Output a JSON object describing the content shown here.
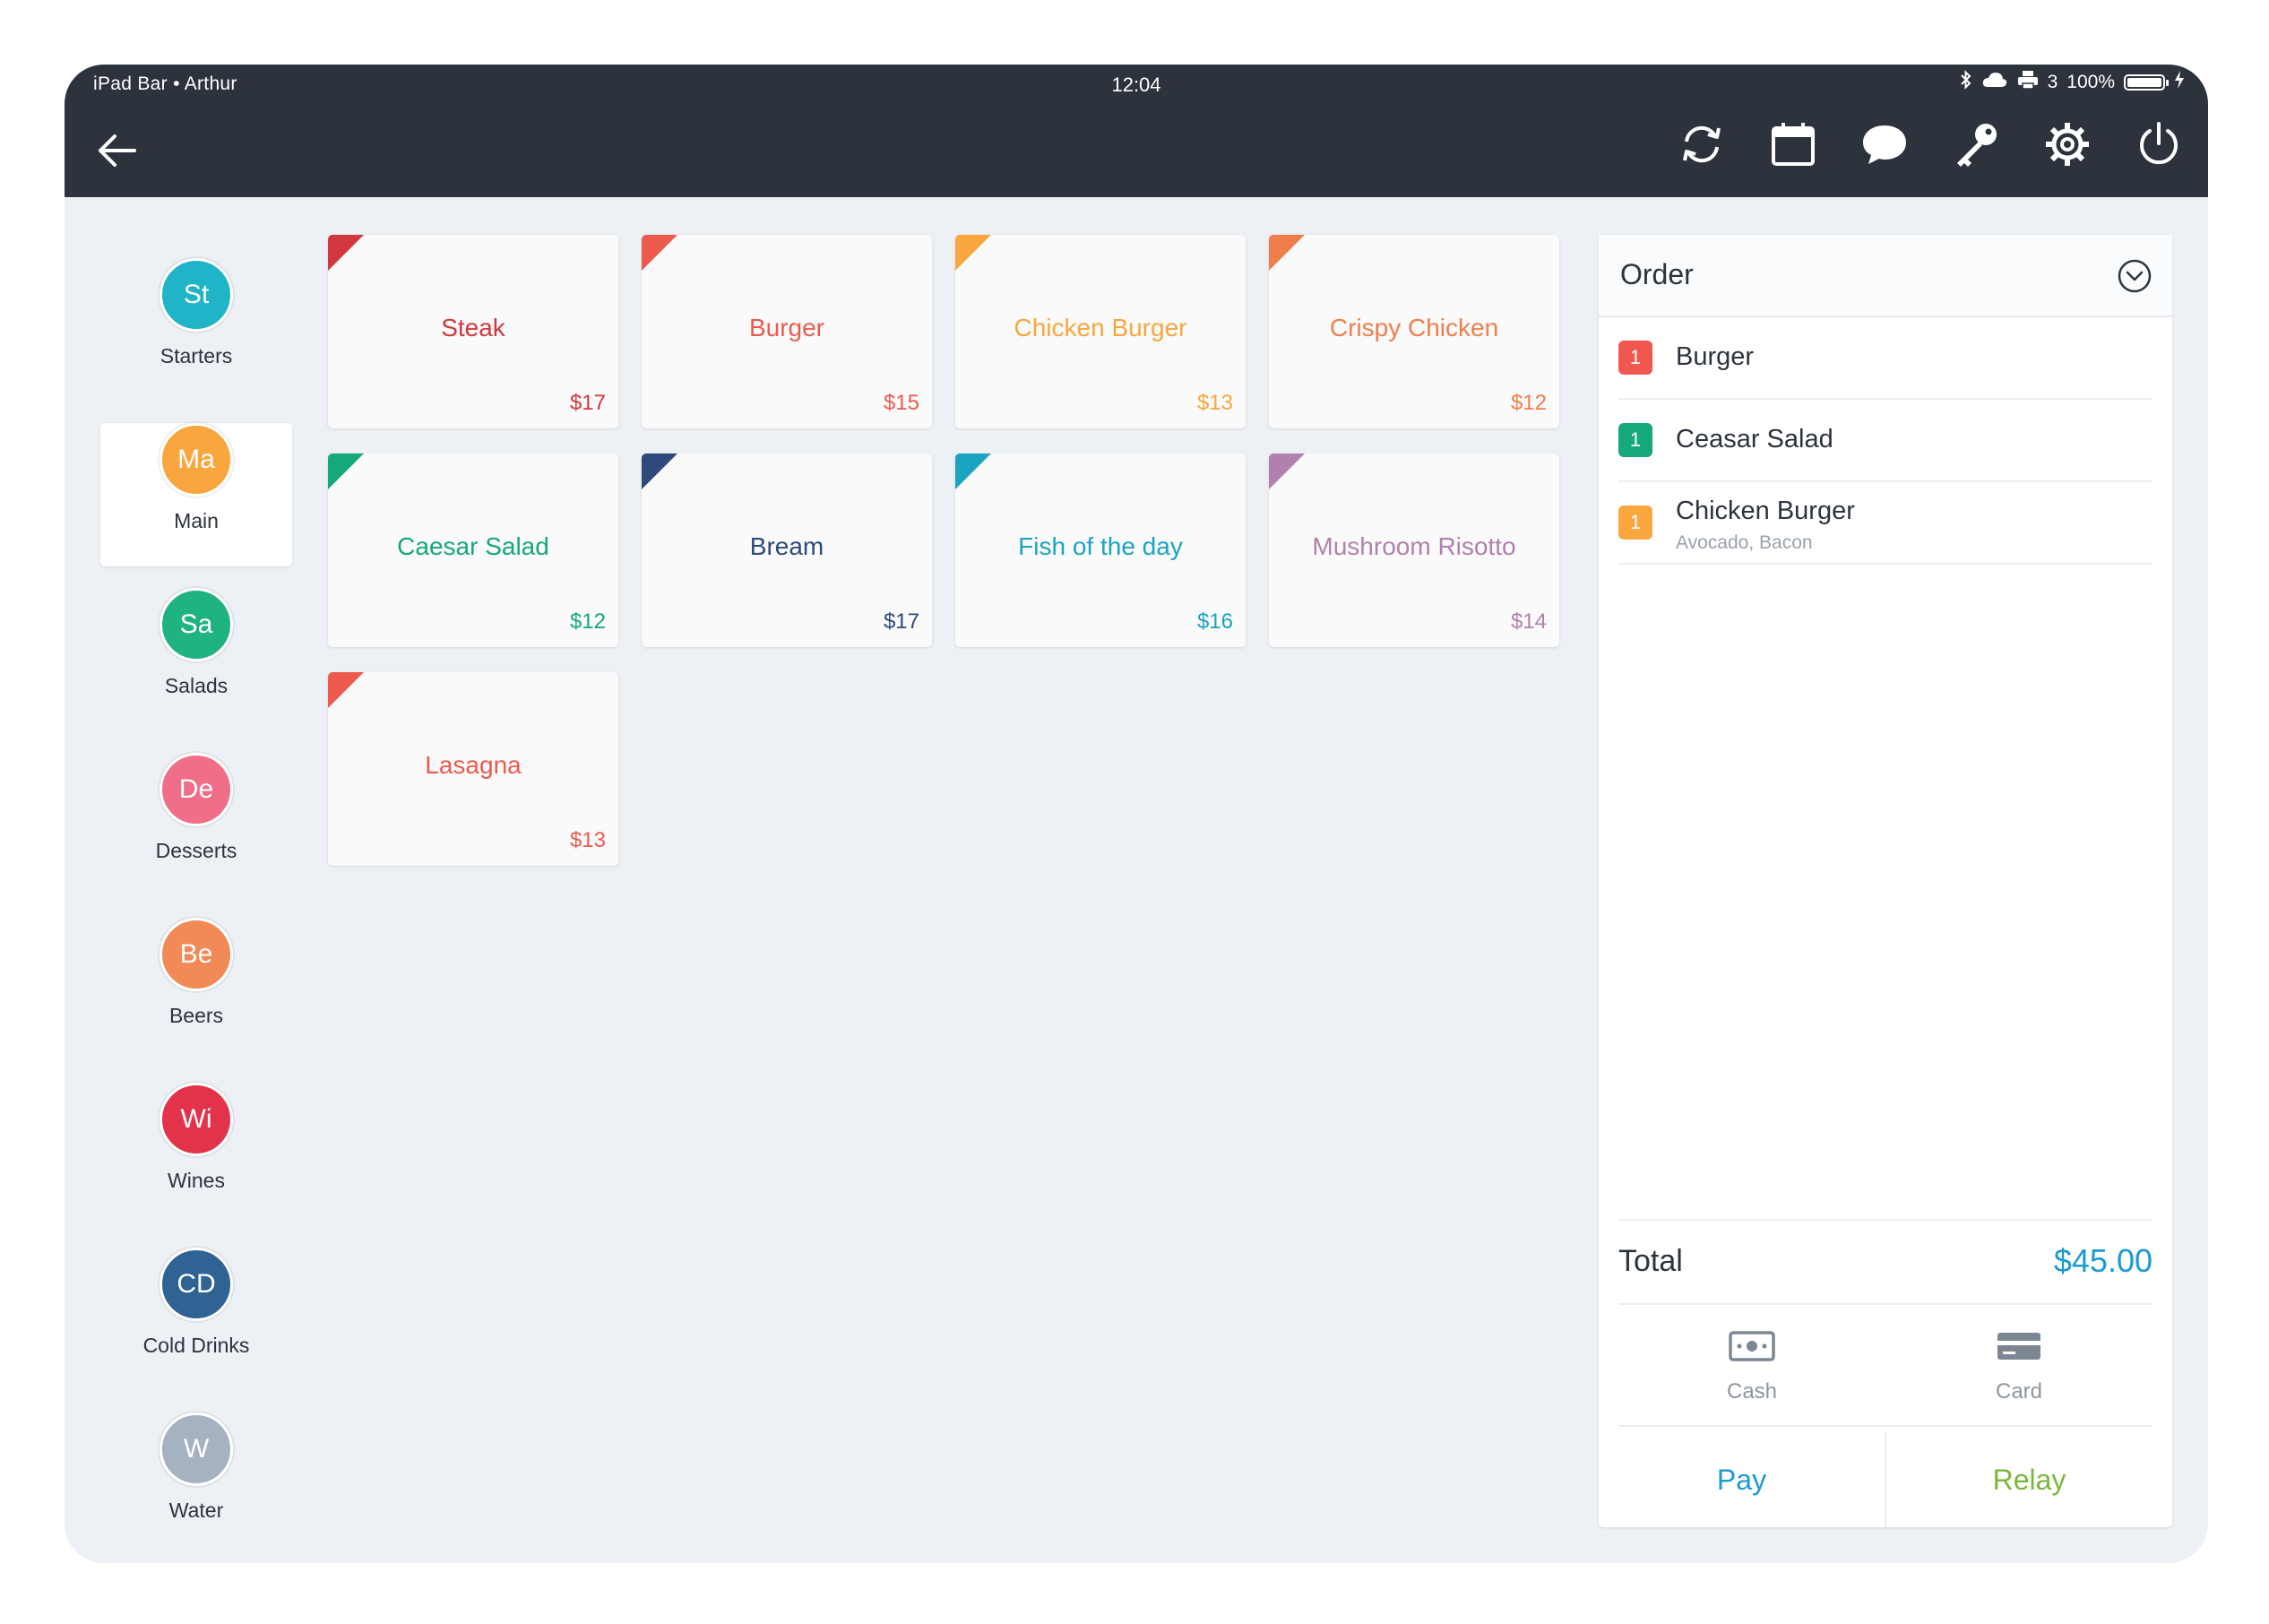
{
  "status_bar": {
    "device": "iPad Bar • Arthur",
    "time": "12:04",
    "printer_count": "3",
    "battery": "100%"
  },
  "toolbar": {
    "icons": [
      "back-arrow-icon",
      "sync-icon",
      "calendar-icon",
      "chat-icon",
      "key-icon",
      "settings-icon",
      "power-icon"
    ]
  },
  "categories": [
    {
      "abbr": "St",
      "label": "Starters",
      "color": "#1fb4c8"
    },
    {
      "abbr": "Ma",
      "label": "Main",
      "color": "#f9a63e"
    },
    {
      "abbr": "Sa",
      "label": "Salads",
      "color": "#1fb381"
    },
    {
      "abbr": "De",
      "label": "Desserts",
      "color": "#f06e87"
    },
    {
      "abbr": "Be",
      "label": "Beers",
      "color": "#f28a57"
    },
    {
      "abbr": "Wi",
      "label": "Wines",
      "color": "#e2334b"
    },
    {
      "abbr": "CD",
      "label": "Cold Drinks",
      "color": "#2e6394"
    },
    {
      "abbr": "W",
      "label": "Water",
      "color": "#a6b2c2"
    }
  ],
  "products": [
    {
      "name": "Steak",
      "price": "$17",
      "color": "#d1383d"
    },
    {
      "name": "Burger",
      "price": "$15",
      "color": "#ec5a4e"
    },
    {
      "name": "Chicken Burger",
      "price": "$13",
      "color": "#f9a63e"
    },
    {
      "name": "Crispy Chicken",
      "price": "$12",
      "color": "#f07e4a"
    },
    {
      "name": "Caesar Salad",
      "price": "$12",
      "color": "#14a87a"
    },
    {
      "name": "Bream",
      "price": "$17",
      "color": "#2e4a7a"
    },
    {
      "name": "Fish of the day",
      "price": "$16",
      "color": "#1aa4c2"
    },
    {
      "name": "Mushroom Risotto",
      "price": "$14",
      "color": "#b280ad"
    },
    {
      "name": "Lasagna",
      "price": "$13",
      "color": "#ec5a4e"
    }
  ],
  "order": {
    "title": "Order",
    "items": [
      {
        "qty": "1",
        "name": "Burger",
        "modifiers": "",
        "color": "#f0584f"
      },
      {
        "qty": "1",
        "name": "Ceasar Salad",
        "modifiers": "",
        "color": "#14a87a"
      },
      {
        "qty": "1",
        "name": "Chicken Burger",
        "modifiers": "Avocado, Bacon",
        "color": "#f9a63e"
      }
    ],
    "total_label": "Total",
    "total_value": "$45.00",
    "payment_methods": {
      "cash": "Cash",
      "card": "Card"
    },
    "actions": {
      "pay": "Pay",
      "relay": "Relay"
    }
  }
}
